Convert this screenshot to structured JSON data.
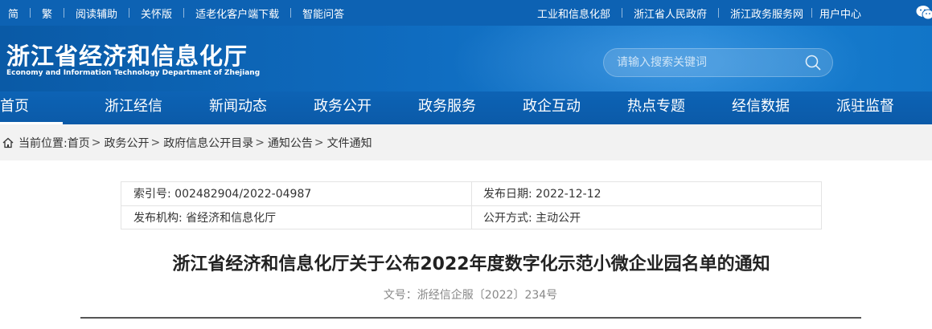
{
  "topbar": {
    "left_links": [
      "简",
      "繁",
      "阅读辅助",
      "关怀版",
      "适老化客户端下载",
      "智能问答"
    ],
    "right_links": [
      "工业和信息化部",
      "浙江省人民政府",
      "浙江政务服务网",
      "用户中心"
    ],
    "wechat_icon": "wechat-icon"
  },
  "header": {
    "title_cn": "浙江省经济和信息化厅",
    "title_en": "Economy and Information Technology Department of Zhejiang",
    "search_placeholder": "请输入搜索关键词",
    "search_icon": "search-icon"
  },
  "nav": {
    "items": [
      "首页",
      "浙江经信",
      "新闻动态",
      "政务公开",
      "政务服务",
      "政企互动",
      "热点专题",
      "经信数据",
      "派驻监督"
    ],
    "active_index": 0
  },
  "breadcrumb": {
    "label": "当前位置:",
    "items": [
      "首页",
      "政务公开",
      "政府信息公开目录",
      "通知公告",
      "文件通知"
    ],
    "separator": ">"
  },
  "meta": {
    "index_no": "索引号: 002482904/2022-04987",
    "publish_date": "发布日期: 2022-12-12",
    "issuer": "发布机构: 省经济和信息化厅",
    "open_mode": "公开方式: 主动公开"
  },
  "article": {
    "title": "浙江省经济和信息化厅关于公布2022年度数字化示范小微企业园名单的通知",
    "doc_number": "文号：浙经信企服〔2022〕234号"
  },
  "colors": {
    "primary_blue": "#0d62b3",
    "breadcrumb_bg": "#f2f2f2"
  }
}
